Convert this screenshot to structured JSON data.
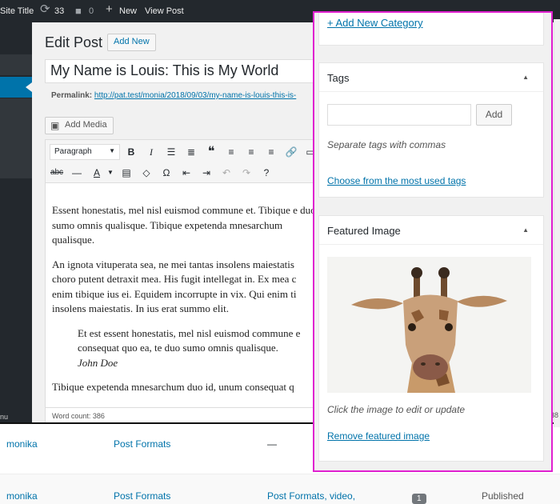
{
  "adminbar": {
    "site_title": "Site Title",
    "updates_count": "33",
    "comments_count": "0",
    "new_label": "New",
    "view_post_label": "View Post"
  },
  "sidebar": {
    "collapse_label": "nu"
  },
  "header": {
    "title": "Edit Post",
    "add_new_label": "Add New"
  },
  "post": {
    "title": "My Name is Louis: This is My World",
    "permalink_label": "Permalink:",
    "permalink_url": "http://pat.test/monia/2018/09/03/my-name-is-louis-this-is-"
  },
  "editor": {
    "add_media_label": "Add Media",
    "format_value": "Paragraph",
    "toolbar_icons": [
      "bold-icon",
      "italic-icon",
      "bullet-list-icon",
      "numbered-list-icon",
      "blockquote-icon",
      "align-left-icon",
      "align-center-icon",
      "align-right-icon",
      "link-icon",
      "strikethrough-icon",
      "horizontal-line-icon",
      "text-color-icon",
      "paste-text-icon",
      "clear-formatting-icon",
      "special-character-icon",
      "outdent-icon",
      "indent-icon",
      "undo-icon",
      "redo-icon",
      "help-icon"
    ],
    "para1": "Essent honestatis, mel nisl euismod commune et. Tibique e duo sumo omnis qualisque. Tibique expetenda mnesarchum qualisque.",
    "para2": "An ignota vituperata sea, ne mei tantas insolens maiestatis choro putent detraxit mea. His fugit intellegat in. Ex mea c enim tibique ius ei. Equidem incorrupte in vix. Qui enim ti insolens maiestatis. In ius erat summo elit.",
    "quote": "Et est essent honestatis, mel nisl euismod commune e consequat quo ea, te duo sumo omnis qualisque.",
    "quote_author": "John Doe",
    "para3": "Tibique expetenda mnesarchum duo id, unum consequat q",
    "word_count": "Word count: 386"
  },
  "categories": {
    "add_new_link": "+ Add New Category"
  },
  "tags": {
    "title": "Tags",
    "input_value": "",
    "add_label": "Add",
    "hint": "Separate tags with commas",
    "choose_link": "Choose from the most used tags"
  },
  "featured_image": {
    "title": "Featured Image",
    "hint": "Click the image to edit or update",
    "remove_link": "Remove featured image"
  },
  "list": {
    "rows": [
      {
        "author": "monika",
        "categories": "Post Formats",
        "tags": "—"
      },
      {
        "author": "monika",
        "categories": "Post Formats",
        "tags": "Post Formats, video,",
        "comments": "1",
        "status": "Published"
      }
    ],
    "edge_number": "38"
  },
  "colors": {
    "accent": "#0073aa",
    "adminbar": "#23282d",
    "highlight_border": "#e020d0"
  }
}
